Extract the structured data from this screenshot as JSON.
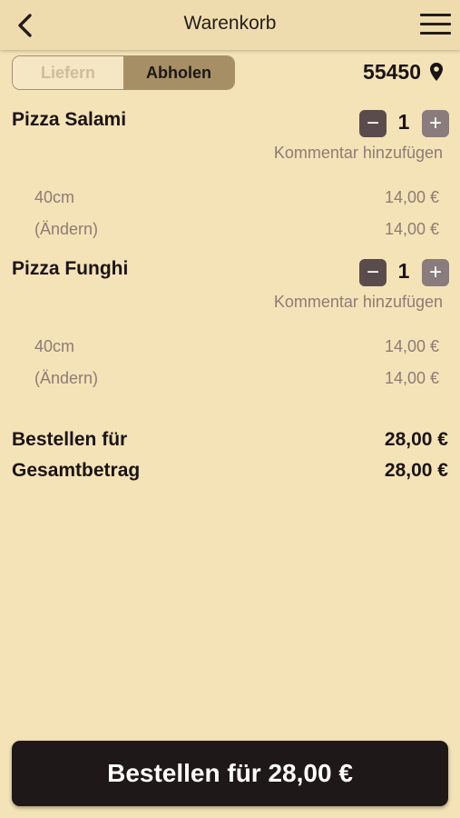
{
  "header": {
    "title": "Warenkorb",
    "back_icon": "chevron-left-icon",
    "menu_icon": "hamburger-menu-icon"
  },
  "mode": {
    "options": [
      "Liefern",
      "Abholen"
    ],
    "selected": "Abholen"
  },
  "location": {
    "postal_code": "55450",
    "icon": "map-pin-icon"
  },
  "items": [
    {
      "name": "Pizza Salami",
      "quantity": "1",
      "comment_label": "Kommentar hinzufügen",
      "lines": [
        {
          "label": "40cm",
          "value": "14,00 €"
        },
        {
          "label": "(Ändern)",
          "value": "14,00 €"
        }
      ]
    },
    {
      "name": "Pizza Funghi",
      "quantity": "1",
      "comment_label": "Kommentar hinzufügen",
      "lines": [
        {
          "label": "40cm",
          "value": "14,00 €"
        },
        {
          "label": "(Ändern)",
          "value": "14,00 €"
        }
      ]
    }
  ],
  "summary": {
    "order_for_label": "Bestellen für",
    "order_for_value": "28,00 €",
    "total_label": "Gesamtbetrag",
    "total_value": "28,00 €"
  },
  "order_button": {
    "label": "Bestellen für 28,00 €"
  },
  "colors": {
    "background": "#f5e3b8",
    "accent": "#a68f64",
    "button": "#1f1818",
    "muted_text": "#8d7c74"
  }
}
